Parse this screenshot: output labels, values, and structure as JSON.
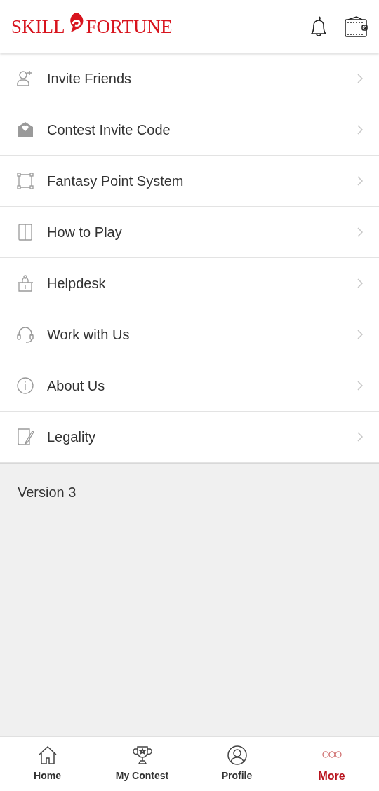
{
  "header": {
    "logo_left": "SKILL",
    "logo_right": "FORTUNE"
  },
  "menu": [
    {
      "label": "Invite Friends"
    },
    {
      "label": "Contest Invite Code"
    },
    {
      "label": "Fantasy Point System"
    },
    {
      "label": "How to Play"
    },
    {
      "label": "Helpdesk"
    },
    {
      "label": "Work with Us"
    },
    {
      "label": "About Us"
    },
    {
      "label": "Legality"
    }
  ],
  "version": "Version 3",
  "bottom_nav": [
    {
      "label": "Home",
      "selected": false
    },
    {
      "label": "My Contest",
      "selected": false
    },
    {
      "label": "Profile",
      "selected": false
    },
    {
      "label": "More",
      "selected": true
    }
  ]
}
